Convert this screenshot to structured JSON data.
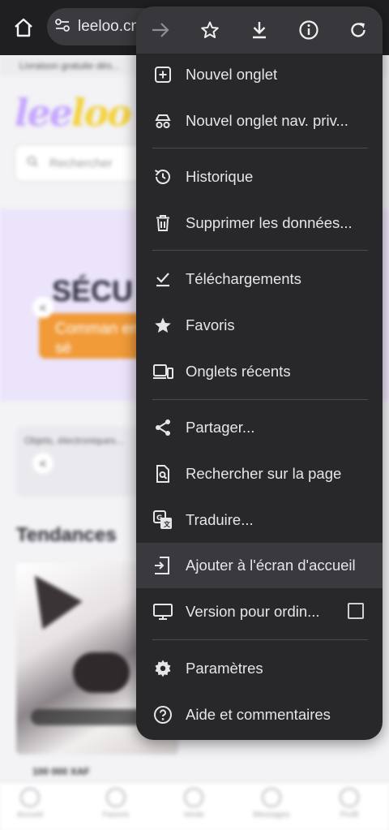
{
  "address_bar": {
    "url": "leeloo.cn"
  },
  "page": {
    "top_strip": "Livraison gratuite dès...",
    "logo": [
      "lee",
      "loo"
    ],
    "search_placeholder": "Rechercher",
    "hero_title": "SÉCU",
    "hero_cta": "Comman en sé",
    "hero_arrow": "<",
    "category_text": "Objets, électroniques...",
    "category_arrow": "<",
    "section_title": "Tendances",
    "price": "100 000 XAF",
    "bottom_nav": [
      "Accueil",
      "Favoris",
      "Vente",
      "Messages",
      "Profil"
    ]
  },
  "menu": {
    "toolbar": [
      {
        "name": "forward-icon",
        "glyph": "→"
      },
      {
        "name": "bookmark-star-icon",
        "glyph": "☆"
      },
      {
        "name": "download-icon",
        "glyph": "⤓"
      },
      {
        "name": "info-icon",
        "glyph": "i"
      },
      {
        "name": "reload-icon",
        "glyph": "↻"
      }
    ],
    "items": [
      {
        "label": "Nouvel onglet",
        "icon": "new-tab-icon"
      },
      {
        "label": "Nouvel onglet nav. priv...",
        "icon": "incognito-icon"
      },
      {
        "label": "Historique",
        "icon": "history-icon"
      },
      {
        "label": "Supprimer les données...",
        "icon": "trash-icon"
      },
      {
        "label": "Téléchargements",
        "icon": "downloads-icon"
      },
      {
        "label": "Favoris",
        "icon": "star-icon"
      },
      {
        "label": "Onglets récents",
        "icon": "devices-icon"
      },
      {
        "label": "Partager...",
        "icon": "share-icon"
      },
      {
        "label": "Rechercher sur la page",
        "icon": "find-in-page-icon"
      },
      {
        "label": "Traduire...",
        "icon": "translate-icon"
      },
      {
        "label": "Ajouter à l'écran d'accueil",
        "icon": "add-to-home-icon"
      },
      {
        "label": "Version pour ordin...",
        "icon": "desktop-icon",
        "checkbox": false
      },
      {
        "label": "Paramètres",
        "icon": "settings-gear-icon"
      },
      {
        "label": "Aide et commentaires",
        "icon": "help-icon"
      }
    ]
  }
}
